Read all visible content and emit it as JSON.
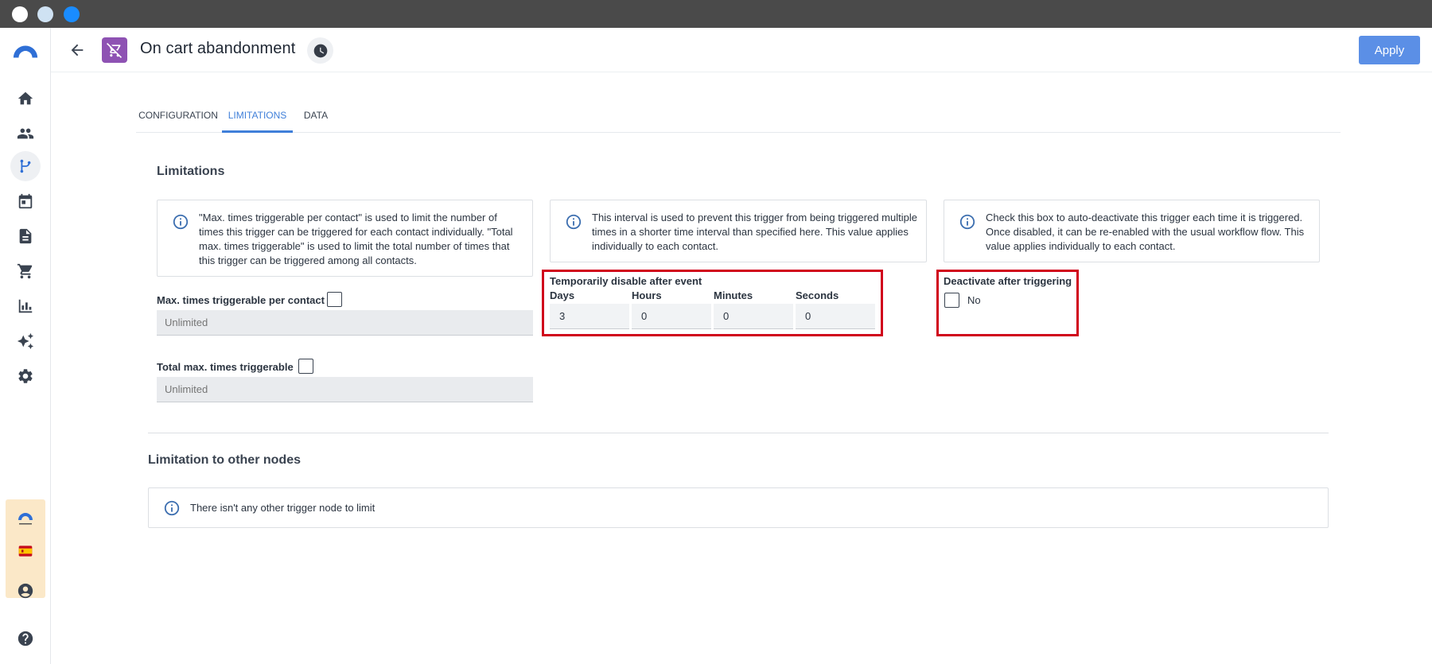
{
  "header": {
    "title": "On cart abandonment",
    "apply_label": "Apply"
  },
  "tabs": [
    {
      "label": "CONFIGURATION",
      "active": false
    },
    {
      "label": "LIMITATIONS",
      "active": true
    },
    {
      "label": "DATA",
      "active": false
    }
  ],
  "sidebar": {
    "icons": [
      "logo-icon",
      "home-icon",
      "contacts-icon",
      "workflow-icon",
      "calendar-icon",
      "document-icon",
      "cart-icon",
      "analytics-icon",
      "sparkle-icon",
      "settings-icon",
      "brand-logo-icon",
      "spain-flag-icon",
      "account-icon",
      "help-icon"
    ]
  },
  "limitations": {
    "title": "Limitations",
    "info_contact": "\"Max. times triggerable per contact\" is used to limit the number of times this trigger can be triggered for each contact individually. \"Total max. times triggerable\" is used to limit the total number of times that this trigger can be triggered among all contacts.",
    "info_interval": "This interval is used to prevent this trigger from being triggered multiple times in a shorter time interval than specified here. This value applies individually to each contact.",
    "info_deactivate": "Check this box to auto-deactivate this trigger each time it is triggered. Once disabled, it can be re-enabled with the usual workflow flow. This value applies individually to each contact.",
    "max_per_contact_label": "Max. times triggerable per contact",
    "max_per_contact_placeholder": "Unlimited",
    "total_max_label": "Total max. times triggerable",
    "total_max_placeholder": "Unlimited",
    "temp_disable_label": "Temporarily disable after event",
    "days_label": "Days",
    "days_value": "3",
    "hours_label": "Hours",
    "hours_value": "0",
    "minutes_label": "Minutes",
    "minutes_value": "0",
    "seconds_label": "Seconds",
    "seconds_value": "0",
    "deactivate_label": "Deactivate after triggering",
    "deactivate_value": "No"
  },
  "other_nodes": {
    "title": "Limitation to other nodes",
    "info": "There isn't any other trigger node to limit"
  },
  "colors": {
    "accent": "#5b8fe6",
    "tab_active": "#3f7fd9",
    "node_icon": "#8e52b3",
    "highlight": "#d0021b"
  }
}
